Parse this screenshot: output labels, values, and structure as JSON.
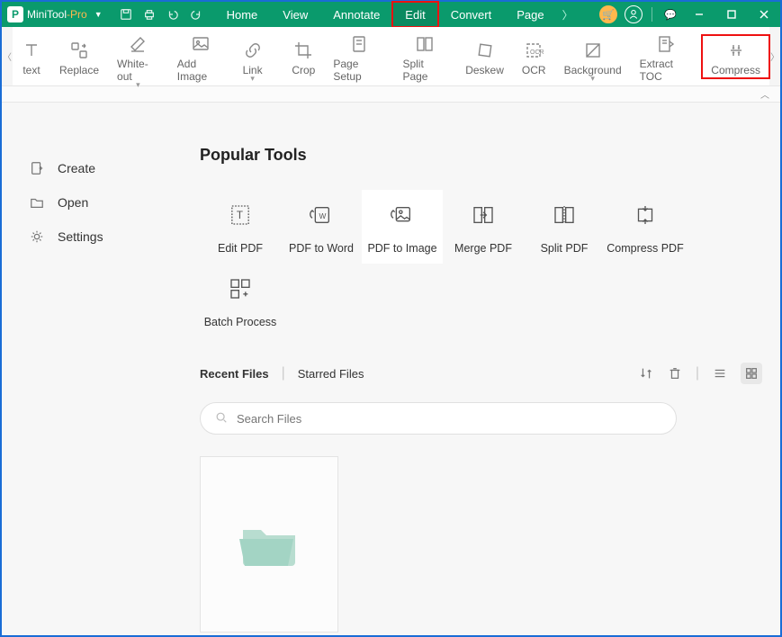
{
  "title": {
    "brand": "MiniTool",
    "suffix": "-Pro"
  },
  "menu": {
    "items": [
      "Home",
      "View",
      "Annotate",
      "Edit",
      "Convert",
      "Page"
    ],
    "active_index": 3,
    "highlighted_index": 3
  },
  "ribbon": {
    "items": [
      {
        "label": "text",
        "sub": ""
      },
      {
        "label": "Replace",
        "sub": ""
      },
      {
        "label": "White-out",
        "sub": "▾"
      },
      {
        "label": "Add Image",
        "sub": ""
      },
      {
        "label": "Link",
        "sub": "▾"
      },
      {
        "label": "Crop",
        "sub": ""
      },
      {
        "label": "Page Setup",
        "sub": ""
      },
      {
        "label": "Split Page",
        "sub": ""
      },
      {
        "label": "Deskew",
        "sub": ""
      },
      {
        "label": "OCR",
        "sub": ""
      },
      {
        "label": "Background",
        "sub": "▾"
      },
      {
        "label": "Extract TOC",
        "sub": ""
      },
      {
        "label": "Compress",
        "sub": ""
      }
    ],
    "highlighted_index": 12
  },
  "sidebar": {
    "items": [
      {
        "label": "Create"
      },
      {
        "label": "Open"
      },
      {
        "label": "Settings"
      }
    ]
  },
  "popular": {
    "title": "Popular Tools",
    "tools": [
      {
        "label": "Edit PDF"
      },
      {
        "label": "PDF to Word"
      },
      {
        "label": "PDF to Image"
      },
      {
        "label": "Merge PDF"
      },
      {
        "label": "Split PDF"
      },
      {
        "label": "Compress PDF"
      },
      {
        "label": "Batch Process"
      }
    ],
    "hover_index": 2
  },
  "files": {
    "tabs": [
      "Recent Files",
      "Starred Files"
    ],
    "active_tab": 0,
    "search_placeholder": "Search Files"
  }
}
